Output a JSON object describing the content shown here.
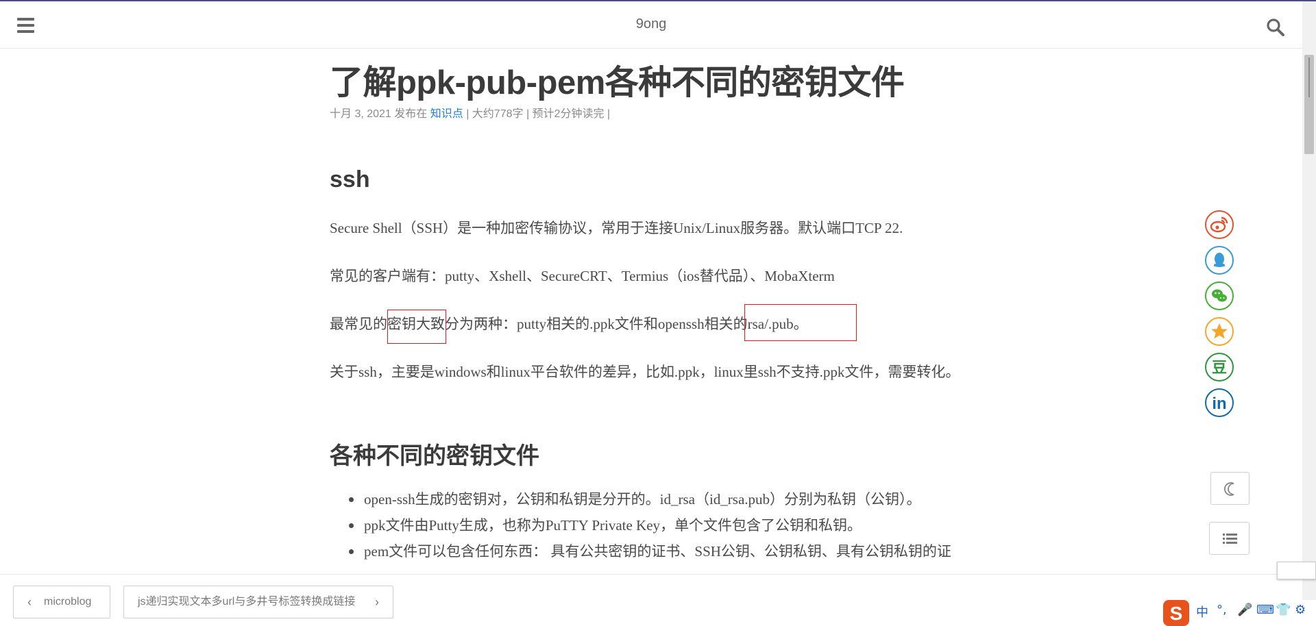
{
  "header": {
    "site_title": "9ong",
    "menu_icon": "hamburger-menu-icon",
    "search_icon": "search-icon"
  },
  "post": {
    "title": "了解ppk-pub-pem各种不同的密钥文件",
    "meta": {
      "date_published": "十月 3, 2021 发布在 ",
      "category": "知识点",
      "word_count": " | 大约778字 | ",
      "read_time": "预计2分钟读完 |"
    },
    "section_ssh": {
      "heading": "ssh",
      "paragraphs": [
        "Secure Shell（SSH）是一种加密传输协议，常用于连接Unix/Linux服务器。默认端口TCP 22.",
        "常见的客户端有：putty、Xshell、SecureCRT、Termius（ios替代品）、MobaXterm",
        "最常见的密钥大致分为两种：putty相关的.ppk文件和openssh相关的rsa/.pub。",
        "关于ssh，主要是windows和linux平台软件的差异，比如.ppk，linux里ssh不支持.ppk文件，需要转化。"
      ]
    },
    "section_keys": {
      "heading": "各种不同的密钥文件",
      "items": [
        "open-ssh生成的密钥对，公钥和私钥是分开的。id_rsa（id_rsa.pub）分别为私钥（公钥）。",
        "ppk文件由Putty生成，也称为PuTTY Private Key，单个文件包含了公钥和私钥。",
        "pem文件可以包含任何东西： 具有公共密钥的证书、SSH公钥、公钥私钥、具有公钥私钥的证"
      ]
    }
  },
  "share": [
    {
      "name": "weibo-share-icon",
      "color": "#e6522c"
    },
    {
      "name": "qq-share-icon",
      "color": "#3a9bd9"
    },
    {
      "name": "wechat-share-icon",
      "color": "#45b035"
    },
    {
      "name": "qzone-star-share-icon",
      "color": "#f2a72a"
    },
    {
      "name": "douban-share-icon",
      "color": "#2e963d"
    },
    {
      "name": "linkedin-share-icon",
      "color": "#0e6cab"
    }
  ],
  "share_douban_char": "豆",
  "share_linkedin_text": "in",
  "tools": {
    "dark_mode_icon": "moon-icon",
    "toc_icon": "list-icon"
  },
  "footer": {
    "prev_label": "microblog",
    "next_label": "js递归实现文本多url与多井号标签转换成链接",
    "prev_arrow": "‹",
    "next_arrow": "›"
  },
  "ime": {
    "logo_char": "S",
    "items": [
      "中",
      "°,",
      "🎤",
      "⌨",
      "👕",
      "⚙"
    ]
  },
  "colors": {
    "link": "#1e7fd6",
    "annotation": "#e01818",
    "ime_brand": "#e8531d"
  }
}
